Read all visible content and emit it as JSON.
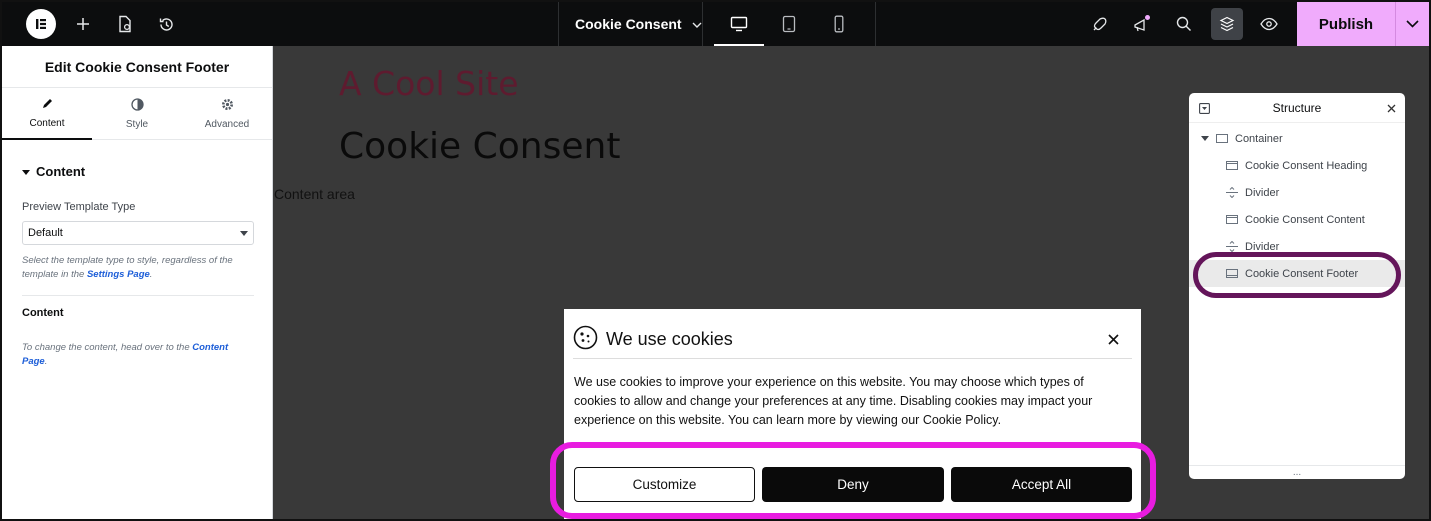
{
  "topbar": {
    "page_name": "Cookie Consent",
    "publish_label": "Publish",
    "colors": {
      "bg": "#0c0d0e",
      "publish": "#f0abfc"
    },
    "icons": [
      "elementor-logo-icon",
      "add-icon",
      "page-settings-icon",
      "history-icon",
      "desktop-icon",
      "tablet-icon",
      "mobile-icon",
      "rocket-icon",
      "notifications-icon",
      "search-icon",
      "structure-icon",
      "preview-eye-icon",
      "chevron-down-icon"
    ]
  },
  "panel": {
    "title": "Edit Cookie Consent Footer",
    "tabs": [
      {
        "label": "Content",
        "icon": "pencil-icon"
      },
      {
        "label": "Style",
        "icon": "half-circle-icon"
      },
      {
        "label": "Advanced",
        "icon": "gear-icon"
      }
    ],
    "section_title": "Content",
    "preview_label": "Preview Template Type",
    "preview_value": "Default",
    "help_prefix": "Select the template type to style, regardless of the template in the ",
    "help_link": "Settings Page",
    "help_suffix": ".",
    "content_heading": "Content",
    "content_help_prefix": "To change the content, head over to the ",
    "content_help_link": "Content Page",
    "content_help_suffix": "."
  },
  "canvas": {
    "site_title": "A Cool Site",
    "page_heading": "Cookie Consent",
    "content_area": "Content area",
    "colors": {
      "bg": "#393939",
      "site_title": "#5e1b2f"
    }
  },
  "cookie": {
    "title": "We use cookies",
    "body": "We use cookies to improve your experience on this website. You may choose which types of cookies to allow and change your preferences at any time. Disabling cookies may impact your experience on this website. You can learn more by viewing our Cookie Policy.",
    "buttons": {
      "customize": "Customize",
      "deny": "Deny",
      "accept": "Accept All"
    },
    "highlight_color": "#e81ce0"
  },
  "structure": {
    "title": "Structure",
    "items": [
      {
        "label": "Container"
      },
      {
        "label": "Cookie Consent Heading"
      },
      {
        "label": "Divider"
      },
      {
        "label": "Cookie Consent Content"
      },
      {
        "label": "Divider"
      },
      {
        "label": "Cookie Consent Footer"
      }
    ],
    "more": "...",
    "ring_color": "#64155a"
  }
}
